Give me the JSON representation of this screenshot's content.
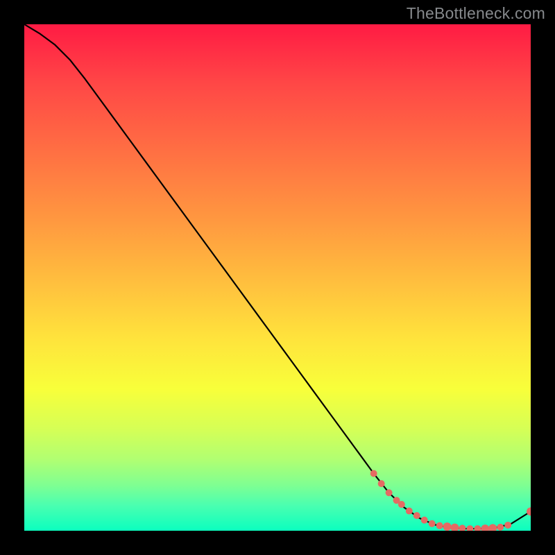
{
  "watermark": "TheBottleneck.com",
  "colors": {
    "curve": "#000000",
    "marker": "#e56a63",
    "frame_bg": "#000000"
  },
  "chart_data": {
    "type": "line",
    "title": "",
    "xlabel": "",
    "ylabel": "",
    "xlim": [
      0,
      100
    ],
    "ylim": [
      0,
      100
    ],
    "grid": false,
    "legend": null,
    "series": [
      {
        "name": "curve",
        "x": [
          0,
          3,
          6,
          9,
          12,
          15,
          18,
          21,
          24,
          27,
          30,
          33,
          36,
          39,
          42,
          45,
          48,
          51,
          54,
          57,
          60,
          63,
          66,
          69,
          72,
          75,
          78,
          81,
          84,
          87,
          90,
          93,
          96,
          100
        ],
        "y": [
          100,
          98.2,
          96.0,
          93.0,
          89.2,
          85.1,
          81.0,
          76.9,
          72.8,
          68.7,
          64.6,
          60.5,
          56.4,
          52.3,
          48.2,
          44.1,
          40.0,
          35.9,
          31.8,
          27.7,
          23.6,
          19.5,
          15.4,
          11.3,
          7.5,
          4.6,
          2.5,
          1.2,
          0.6,
          0.4,
          0.4,
          0.6,
          1.3,
          3.8
        ]
      }
    ],
    "markers": {
      "name": "highlighted-points",
      "x": [
        69,
        70.5,
        72,
        73.5,
        74.5,
        76,
        77.5,
        79,
        80.5,
        82,
        83.5,
        85,
        86.5,
        88,
        89.5,
        91,
        92.5,
        94,
        95.5,
        100
      ],
      "y": [
        11.3,
        9.3,
        7.5,
        6.0,
        5.2,
        3.9,
        3.0,
        2.1,
        1.4,
        1.0,
        0.8,
        0.6,
        0.5,
        0.4,
        0.4,
        0.4,
        0.5,
        0.7,
        1.1,
        3.8
      ],
      "r": [
        5,
        5,
        5,
        5,
        5,
        5,
        5,
        5,
        5,
        5,
        6,
        6,
        5,
        5,
        5,
        6,
        6,
        5,
        5,
        6
      ]
    }
  }
}
